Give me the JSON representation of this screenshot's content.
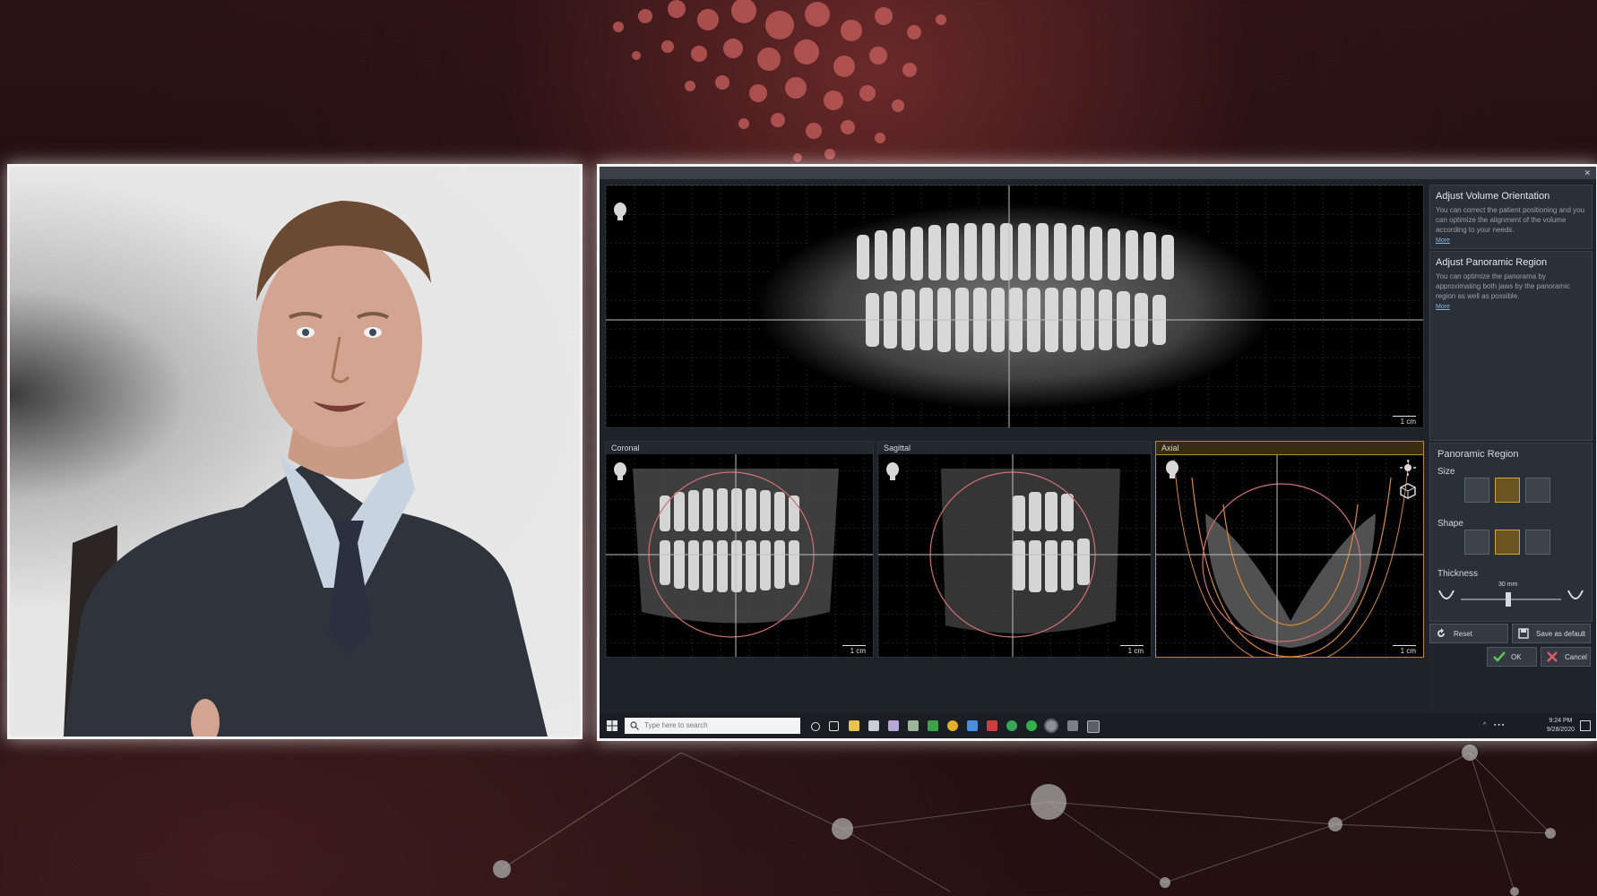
{
  "window": {
    "title": "",
    "views": {
      "panoramic": {
        "scale": "1 cm"
      },
      "coronal": {
        "title": "Coronal",
        "scale": "1 cm"
      },
      "sagittal": {
        "title": "Sagittal",
        "scale": "1 cm"
      },
      "axial": {
        "title": "Axial",
        "scale": "1 cm"
      }
    }
  },
  "side_panel": {
    "adjust_volume": {
      "title": "Adjust Volume Orientation",
      "text": "You can correct the patient positioning and you can optimize the alignment of the volume according to your needs.",
      "more": "More"
    },
    "adjust_panoramic": {
      "title": "Adjust Panoramic Region",
      "text": "You can optimize the panorama by approximating both jaws by the panoramic region as well as possible.",
      "more": "More"
    },
    "panoramic_region": {
      "title": "Panoramic Region",
      "size_label": "Size",
      "shape_label": "Shape",
      "thickness_label": "Thickness",
      "thickness_value": "30 mm",
      "selected_size": 1,
      "selected_shape": 1
    },
    "actions": {
      "reset": "Reset",
      "save_default": "Save as default",
      "ok": "OK",
      "cancel": "Cancel"
    }
  },
  "taskbar": {
    "search_placeholder": "Type here to search",
    "time": "9:24 PM",
    "date": "9/28/2020"
  },
  "colors": {
    "accent": "#d3a23e",
    "panel": "#2a3037",
    "viewport_bg": "#000000",
    "frame": "#f2f2f2"
  }
}
